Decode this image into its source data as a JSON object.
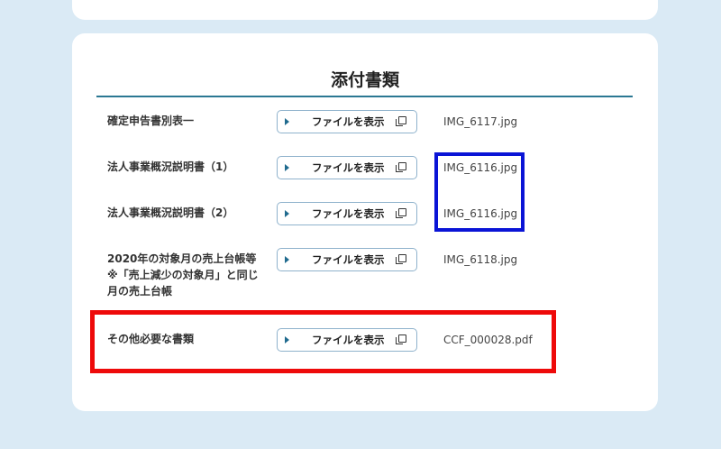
{
  "section": {
    "title": "添付書類"
  },
  "documents": [
    {
      "label_lines": [
        "確定申告書別表一"
      ],
      "button_label": "ファイルを表示",
      "file_name": "IMG_6117.jpg"
    },
    {
      "label_lines": [
        "法人事業概況説明書（1）"
      ],
      "button_label": "ファイルを表示",
      "file_name": "IMG_6116.jpg"
    },
    {
      "label_lines": [
        "法人事業概況説明書（2）"
      ],
      "button_label": "ファイルを表示",
      "file_name": "IMG_6116.jpg"
    },
    {
      "label_lines": [
        "2020年の対象月の売上台帳等",
        "※「売上減少の対象月」と同じ",
        "月の売上台帳"
      ],
      "button_label": "ファイルを表示",
      "file_name": "IMG_6118.jpg"
    },
    {
      "label_lines": [
        "その他必要な書類"
      ],
      "button_label": "ファイルを表示",
      "file_name": "CCF_000028.pdf"
    }
  ],
  "icons": {
    "button_arrow": "play-arrow-icon",
    "button_copy": "copy-icon"
  },
  "colors": {
    "page_background": "#daeaf5",
    "card_background": "#ffffff",
    "title_rule": "#2b7893",
    "button_border": "#8fb2cc",
    "arrow": "#1f6a8e",
    "highlight_blue": "#0a14d6",
    "highlight_red": "#ee0a0a"
  }
}
